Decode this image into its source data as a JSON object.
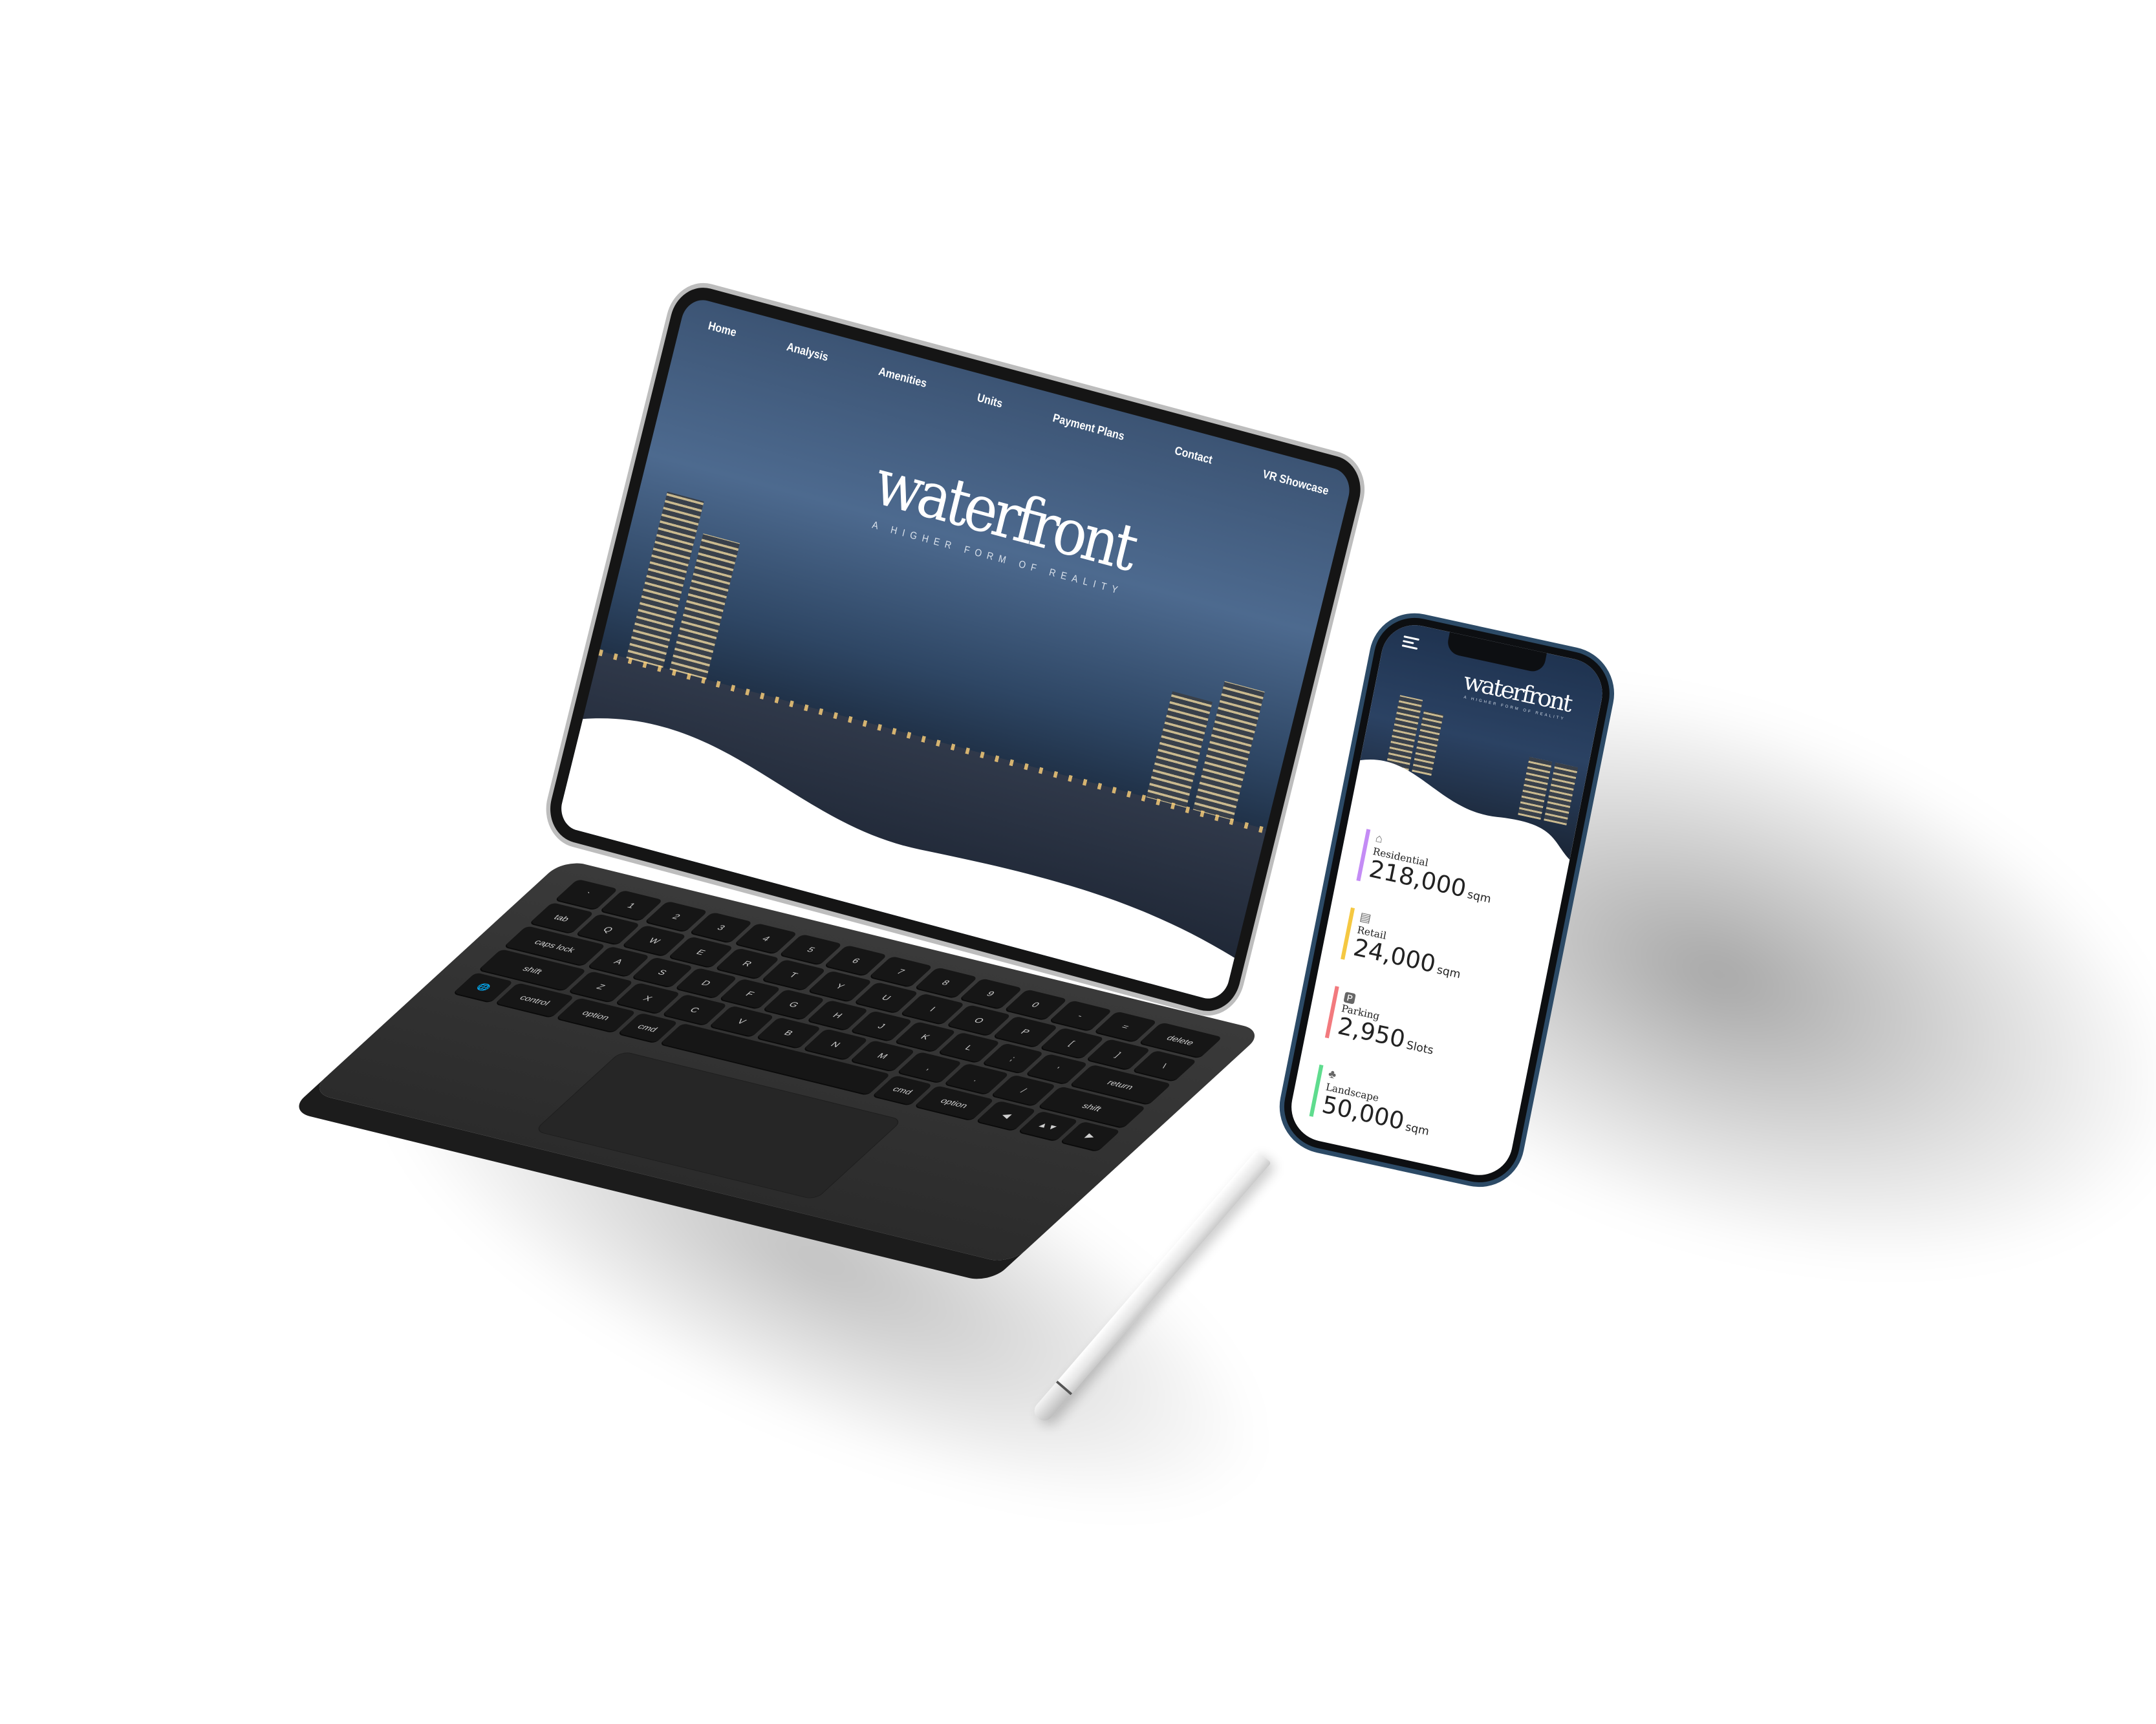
{
  "tablet": {
    "nav": [
      "Home",
      "Analysis",
      "Amenities",
      "Units",
      "Payment Plans",
      "Contact",
      "VR Showcase"
    ],
    "logo": "waterfront",
    "tagline": "A HIGHER FORM OF REALITY"
  },
  "phone": {
    "logo": "waterfront",
    "tagline": "A HIGHER FORM OF REALITY",
    "stats": [
      {
        "label": "Residential",
        "value": "218,000",
        "unit": "sqm",
        "color": "#c48cf5",
        "icon": "house-icon"
      },
      {
        "label": "Retail",
        "value": "24,000",
        "unit": "sqm",
        "color": "#f5c842",
        "icon": "shop-icon"
      },
      {
        "label": "Parking",
        "value": "2,950",
        "unit": "Slots",
        "color": "#f27a7e",
        "icon": "parking-icon"
      },
      {
        "label": "Landscape",
        "value": "50,000",
        "unit": "sqm",
        "color": "#5fdc8e",
        "icon": "tree-icon"
      }
    ]
  },
  "keyboard": {
    "rows": [
      [
        "`",
        "1",
        "2",
        "3",
        "4",
        "5",
        "6",
        "7",
        "8",
        "9",
        "0",
        "-",
        "=",
        "delete"
      ],
      [
        "tab",
        "Q",
        "W",
        "E",
        "R",
        "T",
        "Y",
        "U",
        "I",
        "O",
        "P",
        "[",
        "]",
        "\\"
      ],
      [
        "caps lock",
        "A",
        "S",
        "D",
        "F",
        "G",
        "H",
        "J",
        "K",
        "L",
        ";",
        "'",
        "return"
      ],
      [
        "shift",
        "Z",
        "X",
        "C",
        "V",
        "B",
        "N",
        "M",
        ",",
        ".",
        "/",
        "shift"
      ],
      [
        "🌐",
        "control",
        "option",
        "cmd",
        "",
        "cmd",
        "option",
        "◀",
        "▲▼",
        "▶"
      ]
    ]
  }
}
